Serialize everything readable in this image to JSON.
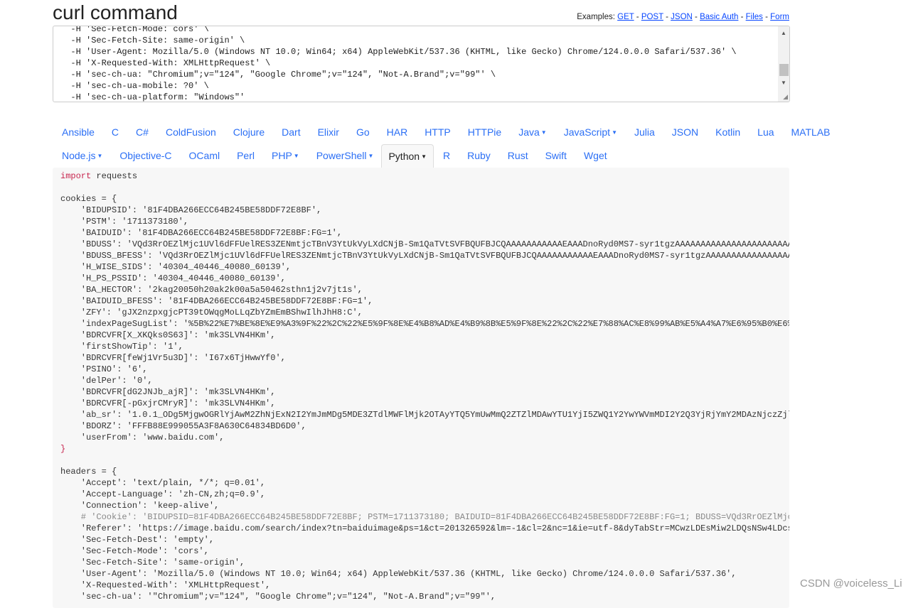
{
  "header": {
    "title": "curl command",
    "examples_label": "Examples:",
    "examples": [
      "GET",
      "POST",
      "JSON",
      "Basic Auth",
      "Files",
      "Form"
    ]
  },
  "curl_input": {
    "lines": [
      "  -H 'Sec-Fetch-Mode: cors' \\",
      "  -H 'Sec-Fetch-Site: same-origin' \\",
      "  -H 'User-Agent: Mozilla/5.0 (Windows NT 10.0; Win64; x64) AppleWebKit/537.36 (KHTML, like Gecko) Chrome/124.0.0.0 Safari/537.36' \\",
      "  -H 'X-Requested-With: XMLHttpRequest' \\",
      "  -H 'sec-ch-ua: \"Chromium\";v=\"124\", \"Google Chrome\";v=\"124\", \"Not-A.Brand\";v=\"99\"' \\",
      "  -H 'sec-ch-ua-mobile: ?0' \\",
      "  -H 'sec-ch-ua-platform: \"Windows\"'"
    ]
  },
  "languages": {
    "row1": [
      {
        "label": "Ansible"
      },
      {
        "label": "C"
      },
      {
        "label": "C#"
      },
      {
        "label": "ColdFusion"
      },
      {
        "label": "Clojure"
      },
      {
        "label": "Dart"
      },
      {
        "label": "Elixir"
      },
      {
        "label": "Go"
      },
      {
        "label": "HAR"
      },
      {
        "label": "HTTP"
      },
      {
        "label": "HTTPie"
      },
      {
        "label": "Java",
        "dropdown": true
      },
      {
        "label": "JavaScript",
        "dropdown": true
      },
      {
        "label": "Julia"
      },
      {
        "label": "JSON"
      },
      {
        "label": "Kotlin"
      },
      {
        "label": "Lua"
      },
      {
        "label": "MATLAB"
      }
    ],
    "row2": [
      {
        "label": "Node.js",
        "dropdown": true
      },
      {
        "label": "Objective-C"
      },
      {
        "label": "OCaml"
      },
      {
        "label": "Perl"
      },
      {
        "label": "PHP",
        "dropdown": true
      },
      {
        "label": "PowerShell",
        "dropdown": true
      },
      {
        "label": "Python",
        "dropdown": true,
        "active": true
      },
      {
        "label": "R"
      },
      {
        "label": "Ruby"
      },
      {
        "label": "Rust"
      },
      {
        "label": "Swift"
      },
      {
        "label": "Wget"
      }
    ],
    "selected": "Python"
  },
  "output_code": {
    "lines": [
      "import requests",
      "",
      "cookies = {",
      "    'BIDUPSID': '81F4DBA266ECC64B245BE58DDF72E8BF',",
      "    'PSTM': '1711373180',",
      "    'BAIDUID': '81F4DBA266ECC64B245BE58DDF72E8BF:FG=1',",
      "    'BDUSS': 'VQd3RrOEZlMjc1UVl6dFFUelRES3ZENmtjcTBnV3YtUkVyLXdCNjB-Sm1QaTVtSVFBQUFBJCQAAAAAAAAAAAEAAADnoRyd0MS7-syr1tgzAAAAAAAAAAAAAAAAAAAAAAAAAAAA",
      "    'BDUSS_BFESS': 'VQd3RrOEZlMjc1UVl6dFFUelRES3ZENmtjcTBnV3YtUkVyLXdCNjB-Sm1QaTVtSVFBQUFBJCQAAAAAAAAAAAEAAADnoRyd0MS7-syr1tgzAAAAAAAAAAAAAAAAAAAAAAAAA",
      "    'H_WISE_SIDS': '40304_40446_40080_60139',",
      "    'H_PS_PSSID': '40304_40446_40080_60139',",
      "    'BA_HECTOR': '2kag20050h20ak2k00a5a50462sthn1j2v7jt1s',",
      "    'BAIDUID_BFESS': '81F4DBA266ECC64B245BE58DDF72E8BF:FG=1',",
      "    'ZFY': 'gJX2nzpxgjcPT39tOWqgMoLLqZbYZmEmBShwIlhJhH8:C',",
      "    'indexPageSugList': '%5B%22%E7%BE%8E%E9%A3%9F%22%2C%22%E5%9F%8E%E4%B8%AD%E4%B9%8B%E5%9F%8E%22%2C%22%E7%88%AC%E8%99%AB%E5%A4%A7%E6%95%B0%E6%8D%",
      "    'BDRCVFR[X_XKQks0S63]': 'mk3SLVN4HKm',",
      "    'firstShowTip': '1',",
      "    'BDRCVFR[feWj1Vr5u3D]': 'I67x6TjHwwYf0',",
      "    'PSINO': '6',",
      "    'delPer': '0',",
      "    'BDRCVFR[dG2JNJb_ajR]': 'mk3SLVN4HKm',",
      "    'BDRCVFR[-pGxjrCMryR]': 'mk3SLVN4HKm',",
      "    'ab_sr': '1.0.1_ODg5MjgwOGRlYjAwM2ZhNjExN2I2YmJmMDg5MDE3ZTdlMWFlMjk2OTAyYTQ5YmUwMmQ2ZTZlMDAwYTU1YjI5ZWQ1Y2YwYWVmMDI2Y2Q3YjRjYmY2MDAzNjczZjllMD",
      "    'BDORZ': 'FFFB88E999055A3F8A630C64834BD6D0',",
      "    'userFrom': 'www.baidu.com',",
      "}",
      "",
      "headers = {",
      "    'Accept': 'text/plain, */*; q=0.01',",
      "    'Accept-Language': 'zh-CN,zh;q=0.9',",
      "    'Connection': 'keep-alive',",
      "    # 'Cookie': 'BIDUPSID=81F4DBA266ECC64B245BE58DDF72E8BF; PSTM=1711373180; BAIDUID=81F4DBA266ECC64B245BE58DDF72E8BF:FG=1; BDUSS=VQd3RrOEZlMjc1UV",
      "    'Referer': 'https://image.baidu.com/search/index?tn=baiduimage&ps=1&ct=201326592&lm=-1&cl=2&nc=1&ie=utf-8&dyTabStr=MCwzLDEsMiw2LDQsNSw4LDcsOQ%",
      "    'Sec-Fetch-Dest': 'empty',",
      "    'Sec-Fetch-Mode': 'cors',",
      "    'Sec-Fetch-Site': 'same-origin',",
      "    'User-Agent': 'Mozilla/5.0 (Windows NT 10.0; Win64; x64) AppleWebKit/537.36 (KHTML, like Gecko) Chrome/124.0.0.0 Safari/537.36',",
      "    'X-Requested-With': 'XMLHttpRequest',",
      "    'sec-ch-ua': '\"Chromium\";v=\"124\", \"Google Chrome\";v=\"124\", \"Not-A.Brand\";v=\"99\"',"
    ]
  },
  "watermark": "CSDN @voiceless_Li",
  "colors": {
    "link": "#2b6ff5",
    "keyword": "#c7254e",
    "comment": "#888888",
    "code_bg": "#f7f7f7"
  }
}
